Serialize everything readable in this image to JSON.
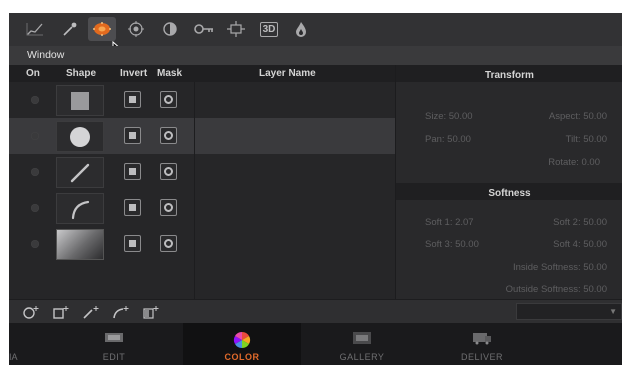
{
  "window": {
    "title": "Window"
  },
  "toolbar": {
    "tools": [
      {
        "icon": "curves-icon",
        "active": false
      },
      {
        "icon": "eyedropper-icon",
        "active": false
      },
      {
        "icon": "power-window-icon",
        "active": true
      },
      {
        "icon": "tracker-icon",
        "active": false
      },
      {
        "icon": "blur-icon",
        "active": false
      },
      {
        "icon": "key-icon",
        "active": false
      },
      {
        "icon": "sizing-icon",
        "active": false
      },
      {
        "icon": "3d-icon",
        "active": false,
        "label": "3D"
      },
      {
        "icon": "color-picker-flame-icon",
        "active": false
      }
    ]
  },
  "table": {
    "columns": {
      "on": "On",
      "shape": "Shape",
      "invert": "Invert",
      "mask": "Mask",
      "layer_name": "Layer Name"
    },
    "rows": [
      {
        "shape": "square",
        "selected": false
      },
      {
        "shape": "circle",
        "selected": true
      },
      {
        "shape": "linear",
        "selected": false
      },
      {
        "shape": "curve",
        "selected": false
      },
      {
        "shape": "gradient",
        "selected": false
      }
    ]
  },
  "transform": {
    "title": "Transform",
    "size": "Size: 50.00",
    "aspect": "Aspect: 50.00",
    "pan": "Pan: 50.00",
    "tilt": "Tilt: 50.00",
    "rotate": "Rotate: 0.00"
  },
  "softness": {
    "title": "Softness",
    "soft1": "Soft 1: 2.07",
    "soft2": "Soft 2: 50.00",
    "soft3": "Soft 3: 50.00",
    "soft4": "Soft 4: 50.00",
    "inside": "Inside Softness: 50.00",
    "outside": "Outside Softness: 50.00"
  },
  "bottom_tools": [
    "add-circle-window-icon",
    "add-square-window-icon",
    "add-linear-window-icon",
    "add-curve-window-icon",
    "add-gradient-window-icon"
  ],
  "pages": {
    "partial_left": "IA",
    "edit": "EDIT",
    "color": "COLOR",
    "gallery": "GALLERY",
    "deliver": "DELIVER",
    "active": "COLOR",
    "accent": "#e16a2b"
  }
}
